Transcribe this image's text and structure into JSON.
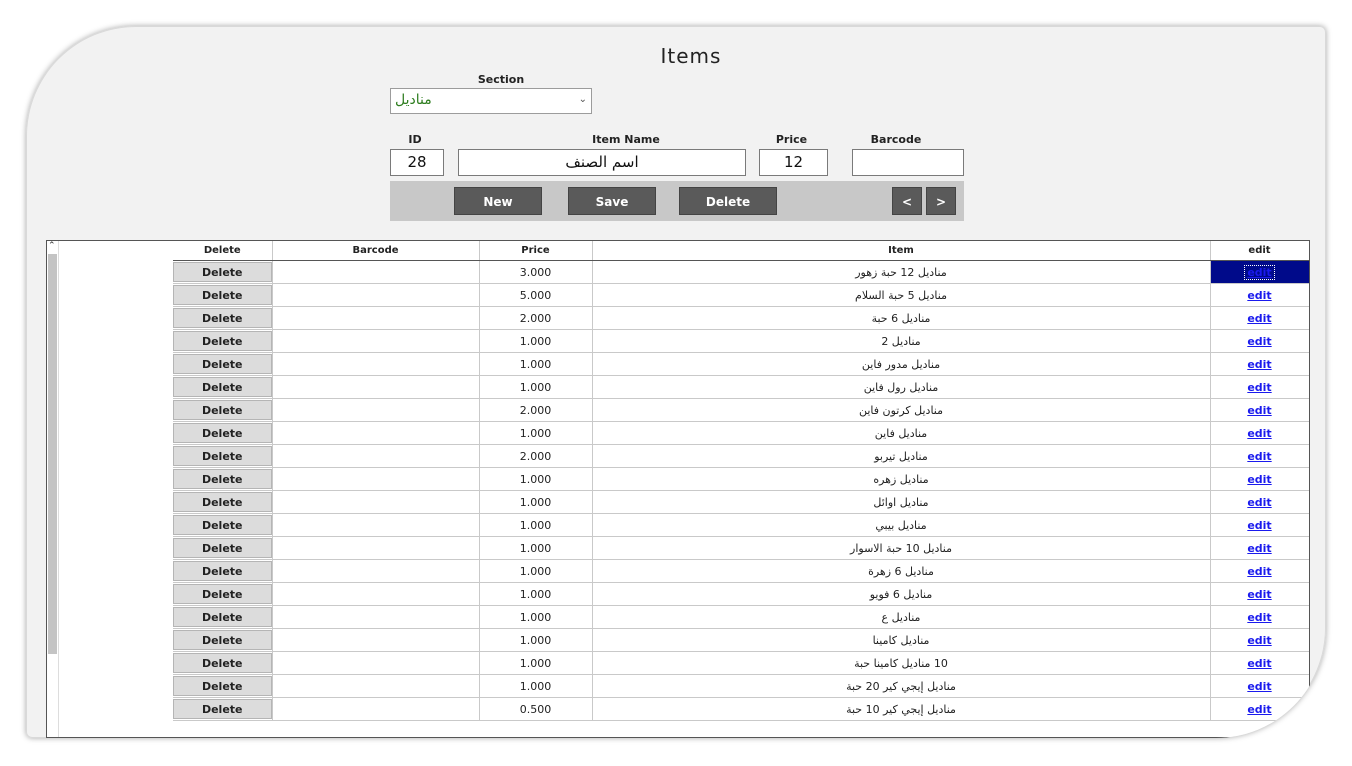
{
  "window": {
    "title": "Items"
  },
  "section": {
    "label": "Section",
    "selected": "مناديل"
  },
  "fields": {
    "id_label": "ID",
    "id_value": "28",
    "name_label": "Item Name",
    "name_value": "اسم الصنف",
    "price_label": "Price",
    "price_value": "12",
    "barcode_label": "Barcode",
    "barcode_value": ""
  },
  "toolbar": {
    "new_label": "New",
    "save_label": "Save",
    "delete_label": "Delete",
    "prev_label": "<",
    "next_label": ">"
  },
  "grid": {
    "columns": [
      "Delete",
      "Barcode",
      "Price",
      "Item",
      "edit"
    ],
    "delete_label": "Delete",
    "edit_label": "edit",
    "selected_row": 0,
    "rows": [
      {
        "barcode": "",
        "price": "3.000",
        "item": "مناديل 12 حبة زهور"
      },
      {
        "barcode": "",
        "price": "5.000",
        "item": "مناديل 5 حبة السلام"
      },
      {
        "barcode": "",
        "price": "2.000",
        "item": "مناديل 6 حبة"
      },
      {
        "barcode": "",
        "price": "1.000",
        "item": "مناديل 2"
      },
      {
        "barcode": "",
        "price": "1.000",
        "item": "مناديل مدور فاين"
      },
      {
        "barcode": "",
        "price": "1.000",
        "item": "مناديل رول فاين"
      },
      {
        "barcode": "",
        "price": "2.000",
        "item": "مناديل كرتون فاين"
      },
      {
        "barcode": "",
        "price": "1.000",
        "item": "مناديل فاين"
      },
      {
        "barcode": "",
        "price": "2.000",
        "item": "مناديل تيربو"
      },
      {
        "barcode": "",
        "price": "1.000",
        "item": "مناديل زهره"
      },
      {
        "barcode": "",
        "price": "1.000",
        "item": "مناديل اوائل"
      },
      {
        "barcode": "",
        "price": "1.000",
        "item": "مناديل بيبي"
      },
      {
        "barcode": "",
        "price": "1.000",
        "item": "مناديل 10 حبة الاسوار"
      },
      {
        "barcode": "",
        "price": "1.000",
        "item": "مناديل 6 زهرة"
      },
      {
        "barcode": "",
        "price": "1.000",
        "item": "مناديل 6 فويو"
      },
      {
        "barcode": "",
        "price": "1.000",
        "item": "مناديل ع"
      },
      {
        "barcode": "",
        "price": "1.000",
        "item": "مناديل كامينا"
      },
      {
        "barcode": "",
        "price": "1.000",
        "item": "10 مناديل كامينا  حبة"
      },
      {
        "barcode": "",
        "price": "1.000",
        "item": "مناديل إيجي كير 20 حبة"
      },
      {
        "barcode": "",
        "price": "0.500",
        "item": "مناديل إيجي كير 10 حبة"
      }
    ]
  }
}
